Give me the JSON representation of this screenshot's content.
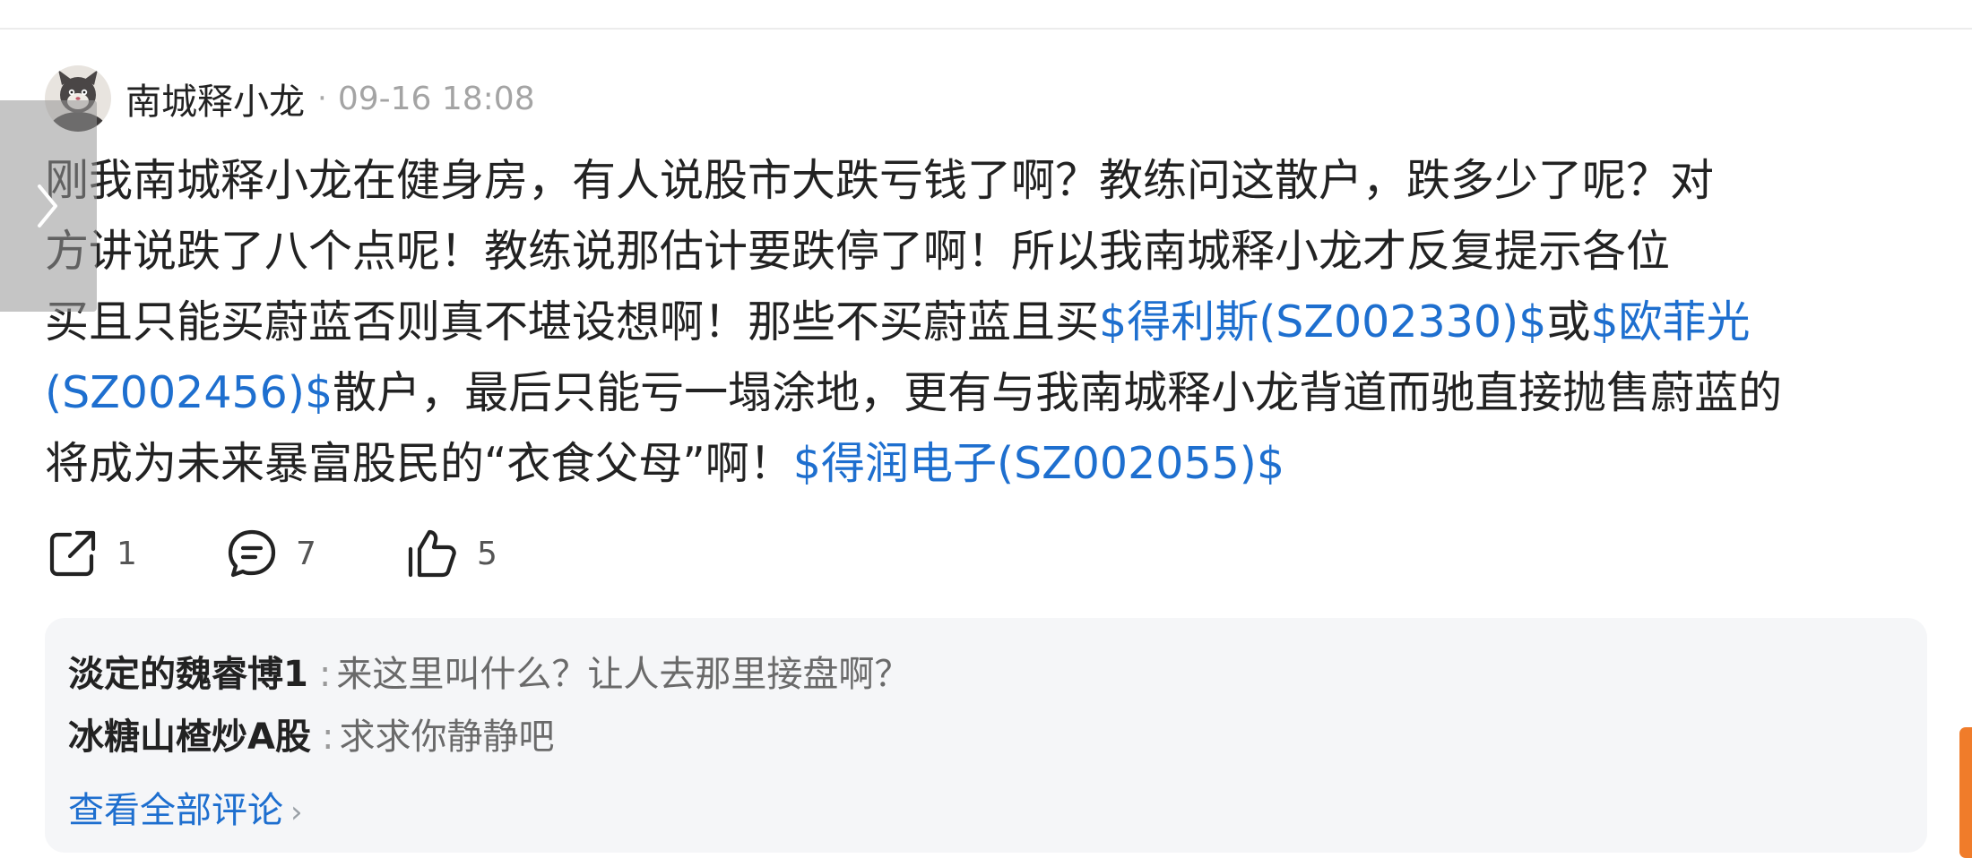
{
  "post": {
    "author": "南城释小龙",
    "separator": "·",
    "time": "09-16 18:08",
    "body": {
      "l1": "刚我南城释小龙在健身房，有人说股市大跌亏钱了啊？教练问这散户，跌多少了呢？对",
      "l2": "方讲说跌了八个点呢！教练说那估计要跌停了啊！所以我南城释小龙才反复提示各位",
      "l3_text": "买且只能买蔚蓝否则真不堪设想啊！那些不买蔚蓝且买",
      "l3_link1": "$得利斯(SZ002330)$",
      "l3_mid": "或",
      "l3_link2_part1": "$欧菲光",
      "l4_link2_part2": "(SZ002456)$",
      "l4_text": "散户，最后只能亏一塌涂地，更有与我南城释小龙背道而驰直接抛售蔚蓝的",
      "l5_text": "将成为未来暴富股民的“衣食父母”啊！",
      "l5_link3": "$得润电子(SZ002055)$"
    }
  },
  "actions": {
    "share_count": "1",
    "comment_count": "7",
    "like_count": "5"
  },
  "comments": [
    {
      "user": "淡定的魏睿博1",
      "sep": ":",
      "text": "来这里叫什么？让人去那里接盘啊？"
    },
    {
      "user": "冰糖山楂炒A股",
      "sep": ":",
      "text": "求求你静静吧"
    }
  ],
  "view_all_label": "查看全部评论",
  "colors": {
    "link": "#1e6fcf",
    "accent_scroll": "#f07c2a",
    "comment_bg": "#f5f6f8"
  },
  "icons": {
    "share": "share-icon",
    "comment": "comment-icon",
    "like": "thumbs-up-icon",
    "side_tab": "chevron-right-icon",
    "view_all": "chevron-right-icon"
  }
}
